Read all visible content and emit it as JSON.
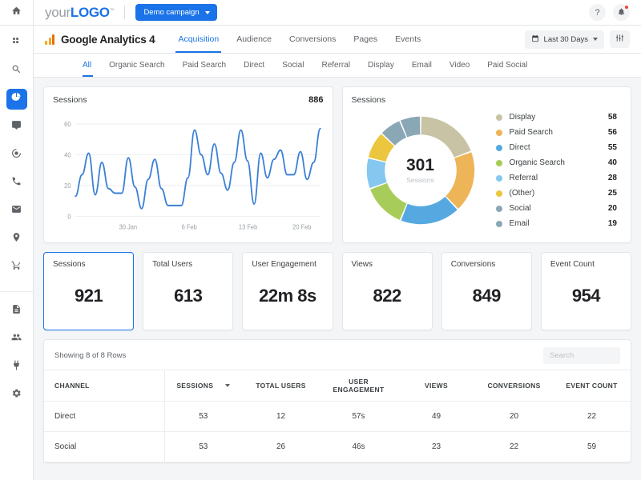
{
  "topbar": {
    "home_icon": "home-icon",
    "logo_prefix": "your",
    "logo_bold": "LOGO",
    "logo_tm": "™",
    "campaign_label": "Demo campaign",
    "help_label": "?",
    "notification_icon": "bell-icon"
  },
  "rail": {
    "items": [
      {
        "icon": "apps-grid-icon",
        "active": false
      },
      {
        "icon": "search-icon",
        "active": false
      },
      {
        "icon": "pie-chart-icon",
        "active": true
      },
      {
        "icon": "chat-bubble-icon",
        "active": false
      },
      {
        "icon": "target-icon",
        "active": false
      },
      {
        "icon": "phone-icon",
        "active": false
      },
      {
        "icon": "envelope-icon",
        "active": false
      },
      {
        "icon": "location-pin-icon",
        "active": false
      },
      {
        "icon": "shopping-cart-icon",
        "active": false
      }
    ],
    "items2": [
      {
        "icon": "document-icon",
        "active": false
      },
      {
        "icon": "people-icon",
        "active": false
      },
      {
        "icon": "plug-icon",
        "active": false
      },
      {
        "icon": "gear-icon",
        "active": false
      }
    ]
  },
  "navbar": {
    "product_title": "Google Analytics 4",
    "tabs": [
      {
        "label": "Acquisition",
        "active": true
      },
      {
        "label": "Audience",
        "active": false
      },
      {
        "label": "Conversions",
        "active": false
      },
      {
        "label": "Pages",
        "active": false
      },
      {
        "label": "Events",
        "active": false
      }
    ],
    "date_range": "Last 30 Days",
    "calendar_icon": "calendar-icon",
    "filter_icon": "sliders-filter-icon"
  },
  "subnav": {
    "tabs": [
      {
        "label": "All",
        "active": true
      },
      {
        "label": "Organic Search",
        "active": false
      },
      {
        "label": "Paid Search",
        "active": false
      },
      {
        "label": "Direct",
        "active": false
      },
      {
        "label": "Social",
        "active": false
      },
      {
        "label": "Referral",
        "active": false
      },
      {
        "label": "Display",
        "active": false
      },
      {
        "label": "Email",
        "active": false
      },
      {
        "label": "Video",
        "active": false
      },
      {
        "label": "Paid Social",
        "active": false
      }
    ]
  },
  "line_card": {
    "title": "Sessions",
    "total": "886"
  },
  "donut_card": {
    "title": "Sessions",
    "center_value": "301",
    "center_label": "Sessions"
  },
  "kpis": [
    {
      "label": "Sessions",
      "value": "921",
      "selected": true
    },
    {
      "label": "Total Users",
      "value": "613",
      "selected": false
    },
    {
      "label": "User Engagement",
      "value": "22m 8s",
      "selected": false
    },
    {
      "label": "Views",
      "value": "822",
      "selected": false
    },
    {
      "label": "Conversions",
      "value": "849",
      "selected": false
    },
    {
      "label": "Event Count",
      "value": "954",
      "selected": false
    }
  ],
  "table": {
    "showing": "Showing 8 of 8 Rows",
    "search_placeholder": "Search",
    "columns": [
      "CHANNEL",
      "SESSIONS",
      "TOTAL USERS",
      "USER ENGAGEMENT",
      "VIEWS",
      "CONVERSIONS",
      "EVENT COUNT"
    ],
    "sorted_column": "SESSIONS",
    "rows": [
      {
        "channel": "Direct",
        "sessions": "53",
        "total_users": "12",
        "user_engagement": "57s",
        "views": "49",
        "conversions": "20",
        "event_count": "22"
      },
      {
        "channel": "Social",
        "sessions": "53",
        "total_users": "26",
        "user_engagement": "46s",
        "views": "23",
        "conversions": "22",
        "event_count": "59"
      }
    ]
  },
  "chart_data": [
    {
      "type": "line",
      "title": "Sessions",
      "total": 886,
      "ylabel": "",
      "xlabel": "",
      "ylim": [
        0,
        65
      ],
      "yticks": [
        0,
        20,
        40,
        60
      ],
      "xticks": [
        "30 Jan",
        "6 Feb",
        "13 Feb",
        "20 Feb"
      ],
      "grid": true,
      "color": "#3a7fd5",
      "series": [
        {
          "name": "Sessions",
          "values": [
            13,
            27,
            41,
            14,
            35,
            18,
            15,
            15,
            38,
            19,
            5,
            24,
            37,
            18,
            7,
            7,
            7,
            25,
            56,
            40,
            27,
            47,
            28,
            17,
            35,
            56,
            36,
            8,
            41,
            25,
            37,
            43,
            27,
            27,
            42,
            24,
            35,
            57
          ]
        }
      ]
    },
    {
      "type": "pie",
      "title": "Sessions",
      "center_value": 301,
      "center_label": "Sessions",
      "donut": true,
      "legend_position": "right",
      "labels": [
        "Display",
        "Paid Search",
        "Direct",
        "Organic Search",
        "Referral",
        "(Other)",
        "Social",
        "Email"
      ],
      "values": [
        58,
        56,
        55,
        40,
        28,
        25,
        20,
        19
      ],
      "colors": [
        "#c9c3a6",
        "#eeb558",
        "#56a9e0",
        "#a8cc59",
        "#85c7ef",
        "#ecc63f",
        "#8aa7b5",
        "#8aa7b5"
      ]
    }
  ]
}
